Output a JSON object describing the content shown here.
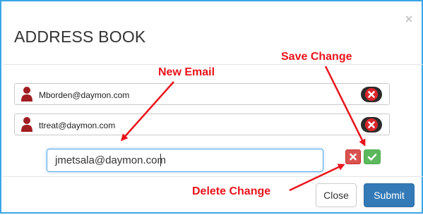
{
  "dialog": {
    "title": "ADDRESS BOOK",
    "close_glyph": "×"
  },
  "contacts": [
    {
      "email": "Mborden@daymon.com",
      "icon": "person-icon",
      "action_icon": "remove-icon"
    },
    {
      "email": "ttreat@daymon.com",
      "icon": "person-icon",
      "action_icon": "remove-icon"
    }
  ],
  "new_email": {
    "value": "jmetsala@daymon.com"
  },
  "row_actions": {
    "delete_icon": "x-icon",
    "save_icon": "check-icon"
  },
  "footer": {
    "close_label": "Close",
    "submit_label": "Submit"
  },
  "annotations": {
    "new_email": "New Email",
    "save_change": "Save Change",
    "delete_change": "Delete Change"
  },
  "colors": {
    "frame_border": "#3aa6e6",
    "annotation": "#e8141b",
    "primary": "#337ab7",
    "danger": "#d9534f",
    "success": "#5cb85c"
  }
}
